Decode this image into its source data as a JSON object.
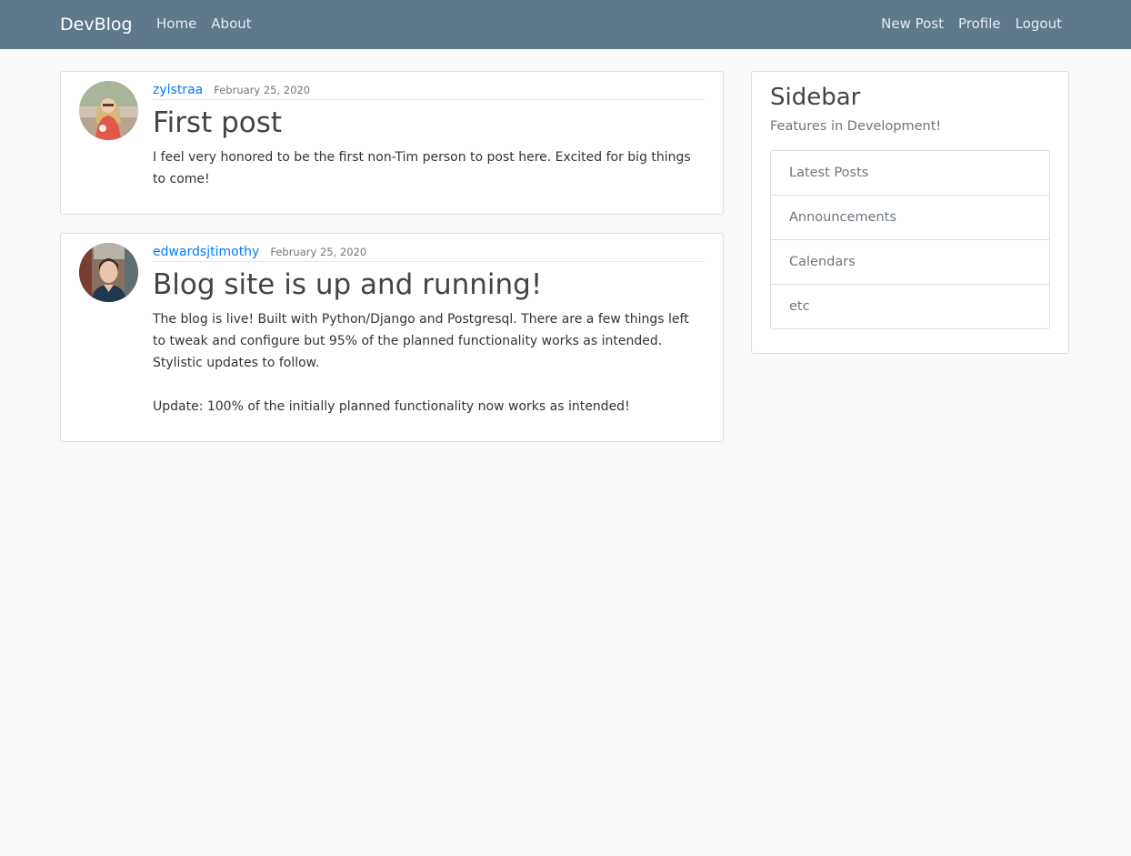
{
  "navbar": {
    "brand": "DevBlog",
    "left_links": [
      "Home",
      "About"
    ],
    "right_links": [
      "New Post",
      "Profile",
      "Logout"
    ],
    "bg_color": "#5f788a"
  },
  "posts": [
    {
      "author": "zylstraa",
      "date": "February 25, 2020",
      "title": "First post",
      "content": "I feel very honored to be the first non-Tim person to post here. Excited for big things to come!"
    },
    {
      "author": "edwardsjtimothy",
      "date": "February 25, 2020",
      "title": "Blog site is up and running!",
      "content": "The blog is live! Built with Python/Django and Postgresql. There are a few things left to tweak and configure but 95% of the planned functionality works as intended. Stylistic updates to follow.\n\nUpdate: 100% of the initially planned functionality now works as intended!"
    }
  ],
  "sidebar": {
    "title": "Sidebar",
    "subtitle": "Features in Development!",
    "items": [
      "Latest Posts",
      "Announcements",
      "Calendars",
      "etc"
    ]
  },
  "colors": {
    "link": "#007bff",
    "muted": "#6c757d",
    "page_bg": "#fafafa"
  }
}
